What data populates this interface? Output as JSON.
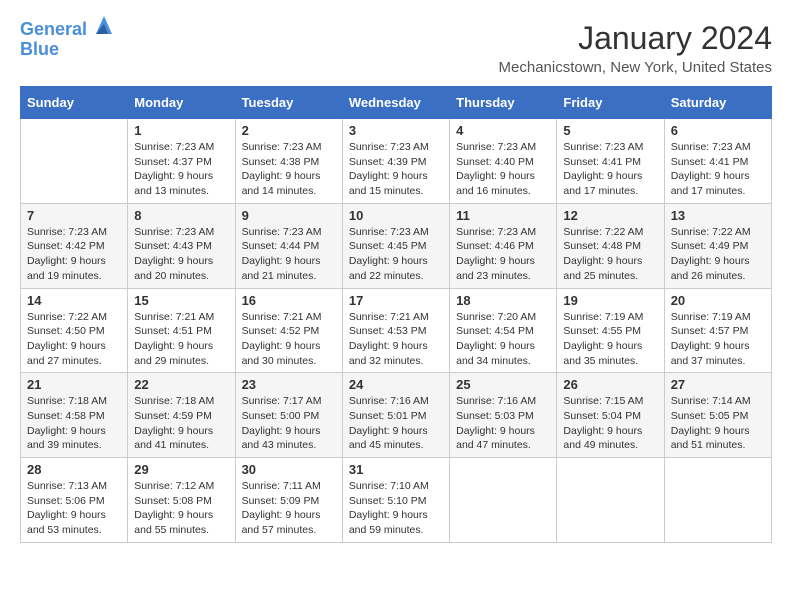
{
  "header": {
    "logo_line1": "General",
    "logo_line2": "Blue",
    "month_title": "January 2024",
    "location": "Mechanicstown, New York, United States"
  },
  "days_of_week": [
    "Sunday",
    "Monday",
    "Tuesday",
    "Wednesday",
    "Thursday",
    "Friday",
    "Saturday"
  ],
  "weeks": [
    [
      {
        "num": "",
        "info": ""
      },
      {
        "num": "1",
        "info": "Sunrise: 7:23 AM\nSunset: 4:37 PM\nDaylight: 9 hours\nand 13 minutes."
      },
      {
        "num": "2",
        "info": "Sunrise: 7:23 AM\nSunset: 4:38 PM\nDaylight: 9 hours\nand 14 minutes."
      },
      {
        "num": "3",
        "info": "Sunrise: 7:23 AM\nSunset: 4:39 PM\nDaylight: 9 hours\nand 15 minutes."
      },
      {
        "num": "4",
        "info": "Sunrise: 7:23 AM\nSunset: 4:40 PM\nDaylight: 9 hours\nand 16 minutes."
      },
      {
        "num": "5",
        "info": "Sunrise: 7:23 AM\nSunset: 4:41 PM\nDaylight: 9 hours\nand 17 minutes."
      },
      {
        "num": "6",
        "info": "Sunrise: 7:23 AM\nSunset: 4:41 PM\nDaylight: 9 hours\nand 17 minutes."
      }
    ],
    [
      {
        "num": "7",
        "info": "Sunrise: 7:23 AM\nSunset: 4:42 PM\nDaylight: 9 hours\nand 19 minutes."
      },
      {
        "num": "8",
        "info": "Sunrise: 7:23 AM\nSunset: 4:43 PM\nDaylight: 9 hours\nand 20 minutes."
      },
      {
        "num": "9",
        "info": "Sunrise: 7:23 AM\nSunset: 4:44 PM\nDaylight: 9 hours\nand 21 minutes."
      },
      {
        "num": "10",
        "info": "Sunrise: 7:23 AM\nSunset: 4:45 PM\nDaylight: 9 hours\nand 22 minutes."
      },
      {
        "num": "11",
        "info": "Sunrise: 7:23 AM\nSunset: 4:46 PM\nDaylight: 9 hours\nand 23 minutes."
      },
      {
        "num": "12",
        "info": "Sunrise: 7:22 AM\nSunset: 4:48 PM\nDaylight: 9 hours\nand 25 minutes."
      },
      {
        "num": "13",
        "info": "Sunrise: 7:22 AM\nSunset: 4:49 PM\nDaylight: 9 hours\nand 26 minutes."
      }
    ],
    [
      {
        "num": "14",
        "info": "Sunrise: 7:22 AM\nSunset: 4:50 PM\nDaylight: 9 hours\nand 27 minutes."
      },
      {
        "num": "15",
        "info": "Sunrise: 7:21 AM\nSunset: 4:51 PM\nDaylight: 9 hours\nand 29 minutes."
      },
      {
        "num": "16",
        "info": "Sunrise: 7:21 AM\nSunset: 4:52 PM\nDaylight: 9 hours\nand 30 minutes."
      },
      {
        "num": "17",
        "info": "Sunrise: 7:21 AM\nSunset: 4:53 PM\nDaylight: 9 hours\nand 32 minutes."
      },
      {
        "num": "18",
        "info": "Sunrise: 7:20 AM\nSunset: 4:54 PM\nDaylight: 9 hours\nand 34 minutes."
      },
      {
        "num": "19",
        "info": "Sunrise: 7:19 AM\nSunset: 4:55 PM\nDaylight: 9 hours\nand 35 minutes."
      },
      {
        "num": "20",
        "info": "Sunrise: 7:19 AM\nSunset: 4:57 PM\nDaylight: 9 hours\nand 37 minutes."
      }
    ],
    [
      {
        "num": "21",
        "info": "Sunrise: 7:18 AM\nSunset: 4:58 PM\nDaylight: 9 hours\nand 39 minutes."
      },
      {
        "num": "22",
        "info": "Sunrise: 7:18 AM\nSunset: 4:59 PM\nDaylight: 9 hours\nand 41 minutes."
      },
      {
        "num": "23",
        "info": "Sunrise: 7:17 AM\nSunset: 5:00 PM\nDaylight: 9 hours\nand 43 minutes."
      },
      {
        "num": "24",
        "info": "Sunrise: 7:16 AM\nSunset: 5:01 PM\nDaylight: 9 hours\nand 45 minutes."
      },
      {
        "num": "25",
        "info": "Sunrise: 7:16 AM\nSunset: 5:03 PM\nDaylight: 9 hours\nand 47 minutes."
      },
      {
        "num": "26",
        "info": "Sunrise: 7:15 AM\nSunset: 5:04 PM\nDaylight: 9 hours\nand 49 minutes."
      },
      {
        "num": "27",
        "info": "Sunrise: 7:14 AM\nSunset: 5:05 PM\nDaylight: 9 hours\nand 51 minutes."
      }
    ],
    [
      {
        "num": "28",
        "info": "Sunrise: 7:13 AM\nSunset: 5:06 PM\nDaylight: 9 hours\nand 53 minutes."
      },
      {
        "num": "29",
        "info": "Sunrise: 7:12 AM\nSunset: 5:08 PM\nDaylight: 9 hours\nand 55 minutes."
      },
      {
        "num": "30",
        "info": "Sunrise: 7:11 AM\nSunset: 5:09 PM\nDaylight: 9 hours\nand 57 minutes."
      },
      {
        "num": "31",
        "info": "Sunrise: 7:10 AM\nSunset: 5:10 PM\nDaylight: 9 hours\nand 59 minutes."
      },
      {
        "num": "",
        "info": ""
      },
      {
        "num": "",
        "info": ""
      },
      {
        "num": "",
        "info": ""
      }
    ]
  ]
}
